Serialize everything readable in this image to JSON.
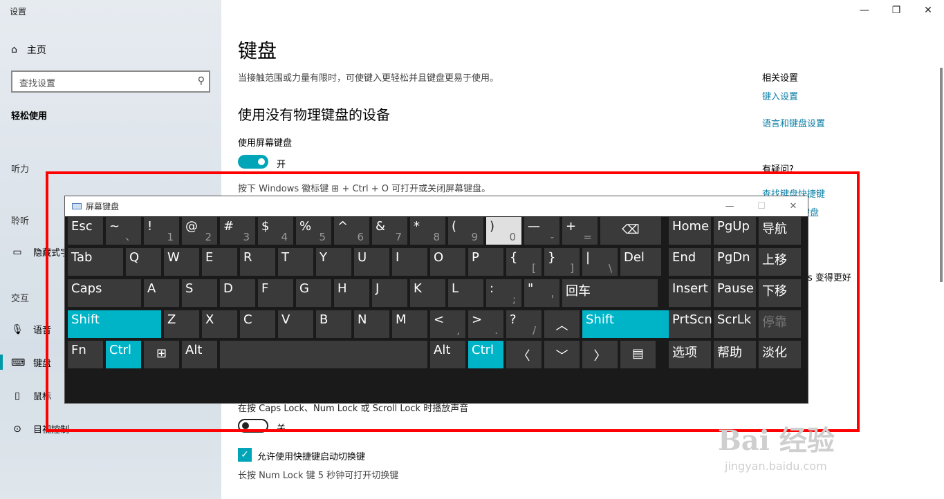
{
  "settings_window": {
    "title": "设置",
    "minimize": "—",
    "restore": "❐",
    "close": "✕"
  },
  "sidebar": {
    "home": "主页",
    "search_placeholder": "查找设置",
    "ease_of_access": "轻松使用",
    "hearing_section": "听力",
    "hearing_section2": "聆听",
    "hidden_item": "隐藏式字幕",
    "interaction_section": "交互",
    "items": [
      {
        "label": "语音"
      },
      {
        "label": "键盘"
      },
      {
        "label": "鼠标"
      },
      {
        "label": "目视控制"
      }
    ]
  },
  "main": {
    "title": "键盘",
    "description": "当接触范围或力量有限时，可使键入更轻松并且键盘更易于使用。",
    "section_title": "使用没有物理键盘的设备",
    "osk_label": "使用屏幕键盘",
    "osk_state": "开",
    "hint": "按下 Windows 徽标键 ⊞ + Ctrl + O 可打开或关闭屏幕键盘。",
    "caps_note": "在按 Caps Lock、Num Lock 或 Scroll Lock 时播放声音",
    "caps_state": "关",
    "shortcut_label": "允许使用快捷键启动切换键",
    "numlock_note": "长按 Num Lock 键 5 秒钟可打开切换键"
  },
  "related": {
    "heading": "相关设置",
    "link1": "键入设置",
    "link2": "语言和键盘设置",
    "question": "有疑问?",
    "link3": "查找键盘快捷键",
    "link4": "键盘",
    "feedback": "s 变得更好"
  },
  "osk": {
    "title": "屏幕键盘",
    "keys": [
      {
        "p": "Esc"
      },
      {
        "p": "~",
        "s": "、"
      },
      {
        "p": "!",
        "s": "1"
      },
      {
        "p": "@",
        "s": "2"
      },
      {
        "p": "#",
        "s": "3"
      },
      {
        "p": "$",
        "s": "4"
      },
      {
        "p": "%",
        "s": "5"
      },
      {
        "p": "^",
        "s": "6"
      },
      {
        "p": "&",
        "s": "7"
      },
      {
        "p": "*",
        "s": "8"
      },
      {
        "p": "(",
        "s": "9"
      },
      {
        "p": ")",
        "s": "0"
      },
      {
        "p": "—",
        "s": "-"
      },
      {
        "p": "+",
        "s": "="
      },
      {
        "p": "⌫"
      },
      {
        "p": "Home"
      },
      {
        "p": "PgUp"
      },
      {
        "p": "导航"
      },
      {
        "p": "Tab"
      },
      {
        "p": "Q"
      },
      {
        "p": "W"
      },
      {
        "p": "E"
      },
      {
        "p": "R"
      },
      {
        "p": "T"
      },
      {
        "p": "Y"
      },
      {
        "p": "U"
      },
      {
        "p": "I"
      },
      {
        "p": "O"
      },
      {
        "p": "P"
      },
      {
        "p": "{",
        "s": "["
      },
      {
        "p": "}",
        "s": "]"
      },
      {
        "p": "|",
        "s": "\\"
      },
      {
        "p": "Del"
      },
      {
        "p": "End"
      },
      {
        "p": "PgDn"
      },
      {
        "p": "上移"
      },
      {
        "p": "Caps"
      },
      {
        "p": "A"
      },
      {
        "p": "S"
      },
      {
        "p": "D"
      },
      {
        "p": "F"
      },
      {
        "p": "G"
      },
      {
        "p": "H"
      },
      {
        "p": "J"
      },
      {
        "p": "K"
      },
      {
        "p": "L"
      },
      {
        "p": ":",
        "s": ";"
      },
      {
        "p": "\"",
        "s": "'"
      },
      {
        "p": "回车"
      },
      {
        "p": "Insert"
      },
      {
        "p": "Pause"
      },
      {
        "p": "下移"
      },
      {
        "p": "Shift"
      },
      {
        "p": "Z"
      },
      {
        "p": "X"
      },
      {
        "p": "C"
      },
      {
        "p": "V"
      },
      {
        "p": "B"
      },
      {
        "p": "N"
      },
      {
        "p": "M"
      },
      {
        "p": "<",
        "s": ","
      },
      {
        "p": ">",
        "s": "."
      },
      {
        "p": "?",
        "s": "/"
      },
      {
        "p": "︿"
      },
      {
        "p": "Shift"
      },
      {
        "p": "PrtScn"
      },
      {
        "p": "ScrLk"
      },
      {
        "p": "停靠"
      },
      {
        "p": "Fn"
      },
      {
        "p": "Ctrl"
      },
      {
        "p": "⊞"
      },
      {
        "p": "Alt"
      },
      {
        "p": ""
      },
      {
        "p": "Alt"
      },
      {
        "p": "Ctrl"
      },
      {
        "p": "〈"
      },
      {
        "p": "﹀"
      },
      {
        "p": "〉"
      },
      {
        "p": "▤"
      },
      {
        "p": "选项"
      },
      {
        "p": "帮助"
      },
      {
        "p": "淡化"
      }
    ]
  },
  "watermark": {
    "logo": "Bai 经验",
    "url": "jingyan.baidu.com"
  }
}
